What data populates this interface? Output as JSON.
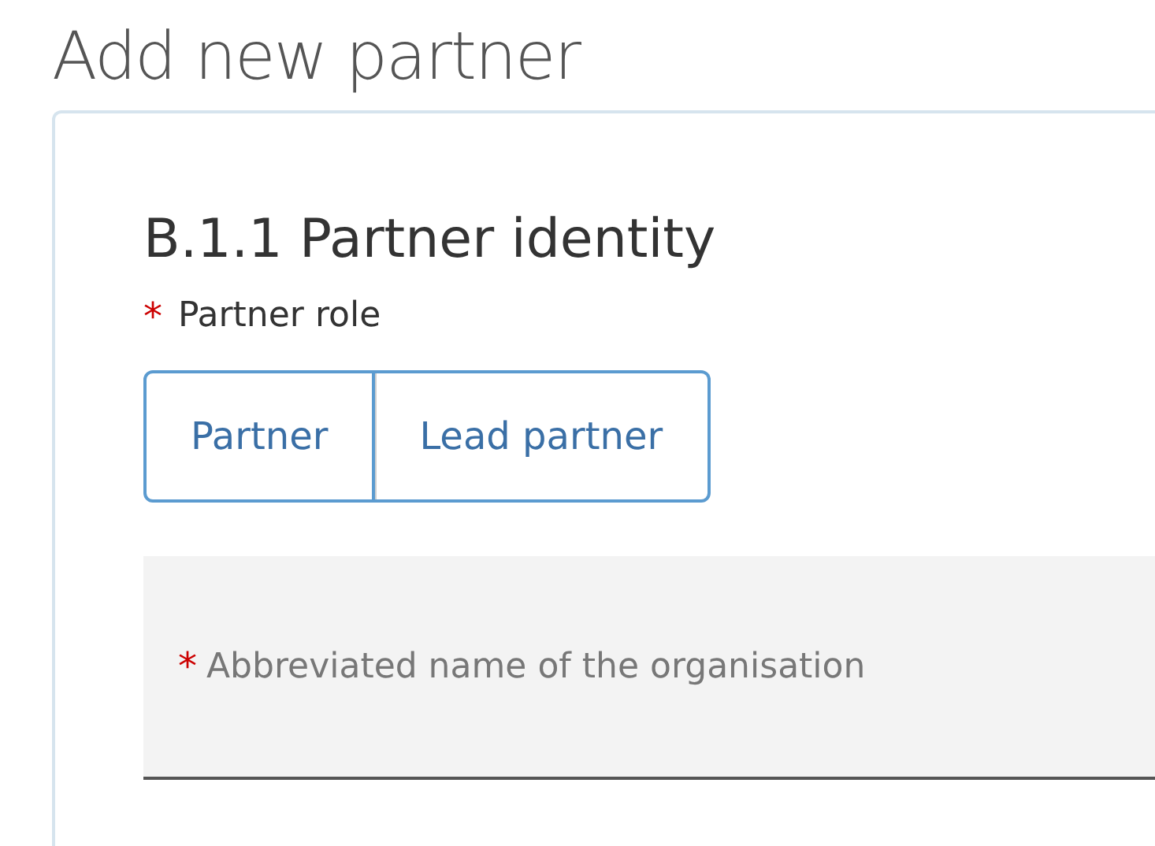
{
  "page_title": "Add new partner",
  "section": {
    "heading": "B.1.1 Partner identity",
    "role_field": {
      "label": "Partner role",
      "required_mark": "*",
      "options": [
        {
          "label": "Partner",
          "selected": false
        },
        {
          "label": "Lead partner",
          "selected": false
        }
      ]
    },
    "name_field": {
      "placeholder": "Abbreviated name of the organisation",
      "required_mark": "*"
    }
  }
}
